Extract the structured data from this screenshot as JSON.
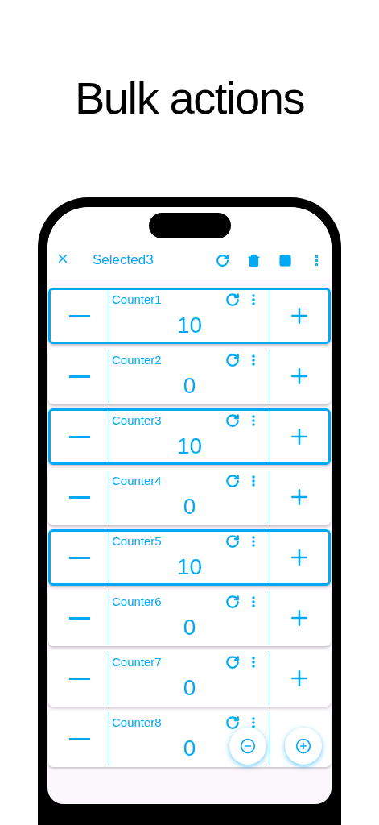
{
  "headline": "Bulk actions",
  "toolbar": {
    "title": "Selected3"
  },
  "counters": [
    {
      "name": "Counter1",
      "value": "10",
      "selected": true
    },
    {
      "name": "Counter2",
      "value": "0",
      "selected": false
    },
    {
      "name": "Counter3",
      "value": "10",
      "selected": true
    },
    {
      "name": "Counter4",
      "value": "0",
      "selected": false
    },
    {
      "name": "Counter5",
      "value": "10",
      "selected": true
    },
    {
      "name": "Counter6",
      "value": "0",
      "selected": false
    },
    {
      "name": "Counter7",
      "value": "0",
      "selected": false
    },
    {
      "name": "Counter8",
      "value": "0",
      "selected": false
    }
  ]
}
